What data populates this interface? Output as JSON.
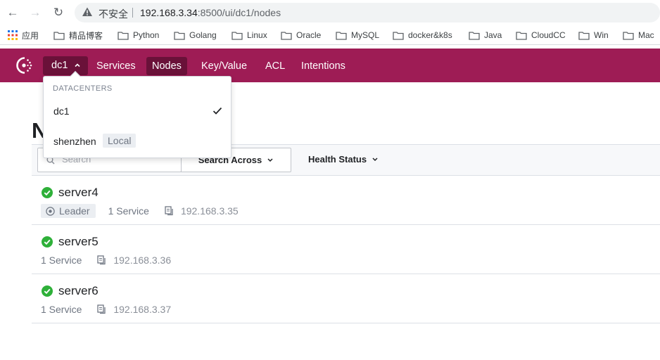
{
  "browser": {
    "insecure_label": "不安全",
    "url_host": "192.168.3.34",
    "url_path": ":8500/ui/dc1/nodes",
    "bookmarks": [
      "应用",
      "精品博客",
      "Python",
      "Golang",
      "Linux",
      "Oracle",
      "MySQL",
      "docker&k8s",
      "Java",
      "CloudCC",
      "Win",
      "Mac"
    ]
  },
  "header": {
    "datacenter": "dc1",
    "nav": [
      "Services",
      "Nodes",
      "Key/Value",
      "ACL",
      "Intentions"
    ],
    "active_nav": "Nodes",
    "accent_color": "#9e1c55"
  },
  "dropdown": {
    "heading": "DATACENTERS",
    "items": [
      {
        "label": "dc1",
        "selected": true
      },
      {
        "label": "shenzhen",
        "badge": "Local"
      }
    ]
  },
  "page": {
    "title": "N"
  },
  "filters": {
    "search_placeholder": "Search",
    "search_across": "Search Across",
    "health_status": "Health Status"
  },
  "nodes": [
    {
      "name": "server4",
      "status": "passing",
      "leader": "Leader",
      "services": "1 Service",
      "address": "192.168.3.35"
    },
    {
      "name": "server5",
      "status": "passing",
      "services": "1 Service",
      "address": "192.168.3.36"
    },
    {
      "name": "server6",
      "status": "passing",
      "services": "1 Service",
      "address": "192.168.3.37"
    }
  ]
}
